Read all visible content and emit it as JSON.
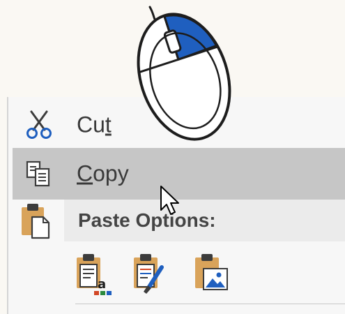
{
  "illustration": {
    "icon": "mouse-left-click-icon",
    "button_color": "#1f5fbf"
  },
  "menu": {
    "items": [
      {
        "label": "Cut",
        "icon": "scissors-icon"
      },
      {
        "label": "Copy",
        "icon": "copy-icon"
      }
    ],
    "paste_options": {
      "label": "Paste Options:",
      "icon": "clipboard-icon",
      "options": [
        {
          "name": "keep-source-formatting",
          "icon": "paste-keep-text-icon"
        },
        {
          "name": "merge-formatting",
          "icon": "paste-merge-formatting-icon"
        },
        {
          "name": "picture",
          "icon": "paste-picture-icon"
        }
      ]
    }
  },
  "colors": {
    "highlight": "#c6c6c6",
    "accent_blue": "#1f5fbf",
    "clipboard_orange": "#d9a35a"
  }
}
